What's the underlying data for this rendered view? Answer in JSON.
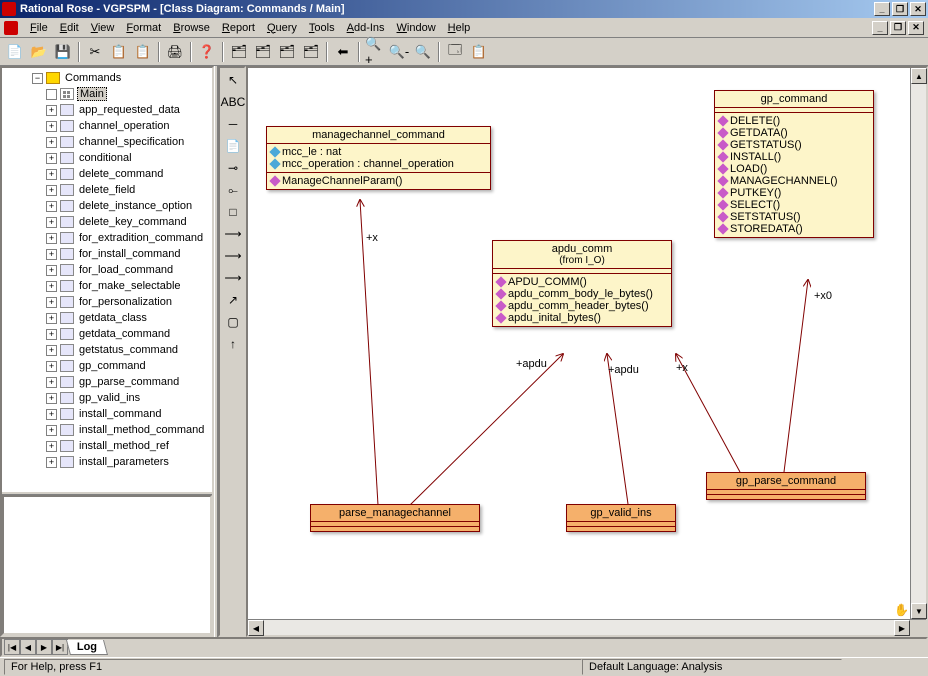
{
  "title": "Rational Rose - VGPSPM - [Class Diagram: Commands / Main]",
  "menu": [
    "File",
    "Edit",
    "View",
    "Format",
    "Browse",
    "Report",
    "Query",
    "Tools",
    "Add-Ins",
    "Window",
    "Help"
  ],
  "toolbar_icons": [
    "📄",
    "📂",
    "💾",
    "|",
    "✂",
    "📋",
    "📋",
    "|",
    "🖨",
    "|",
    "❓",
    "|",
    "🗂",
    "🗂",
    "🗂",
    "🗂",
    "|",
    "⬅",
    "|",
    "🔍+",
    "🔍-",
    "🔍",
    "|",
    "🗔",
    "📋"
  ],
  "toolbox_icons": [
    "↖",
    "ABC",
    "─",
    "📄",
    "⊸",
    "⟜",
    "□",
    "⟶",
    "⟶",
    "⟶",
    "↗",
    "▢",
    "↑"
  ],
  "tree": {
    "root": "Commands",
    "selected": "Main",
    "items": [
      "app_requested_data",
      "channel_operation",
      "channel_specification",
      "conditional",
      "delete_command",
      "delete_field",
      "delete_instance_option",
      "delete_key_command",
      "for_extradition_command",
      "for_install_command",
      "for_load_command",
      "for_make_selectable",
      "for_personalization",
      "getdata_class",
      "getdata_command",
      "getstatus_command",
      "gp_command",
      "gp_parse_command",
      "gp_valid_ins",
      "install_command",
      "install_method_command",
      "install_method_ref",
      "install_parameters"
    ]
  },
  "classes": {
    "managechannel": {
      "name": "managechannel_command",
      "attrs": [
        "mcc_le : nat",
        "mcc_operation : channel_operation"
      ],
      "ops": [
        "ManageChannelParam()"
      ]
    },
    "apdu": {
      "name": "apdu_comm",
      "from": "(from I_O)",
      "ops": [
        "APDU_COMM()",
        "apdu_comm_body_le_bytes()",
        "apdu_comm_header_bytes()",
        "apdu_inital_bytes()"
      ]
    },
    "gp": {
      "name": "gp_command",
      "ops": [
        "DELETE()",
        "GETDATA()",
        "GETSTATUS()",
        "INSTALL()",
        "LOAD()",
        "MANAGECHANNEL()",
        "PUTKEY()",
        "SELECT()",
        "SETSTATUS()",
        "STOREDATA()"
      ]
    },
    "parse_mc": {
      "name": "parse_managechannel"
    },
    "valid_ins": {
      "name": "gp_valid_ins"
    },
    "parse_cmd": {
      "name": "gp_parse_command"
    }
  },
  "assoc_labels": {
    "x1": "+x",
    "apdu1": "+apdu",
    "apdu2": "+apdu",
    "x2": "+x",
    "x0": "+x0"
  },
  "log_tab": "Log",
  "status": {
    "help": "For Help, press F1",
    "lang": "Default Language: Analysis"
  }
}
